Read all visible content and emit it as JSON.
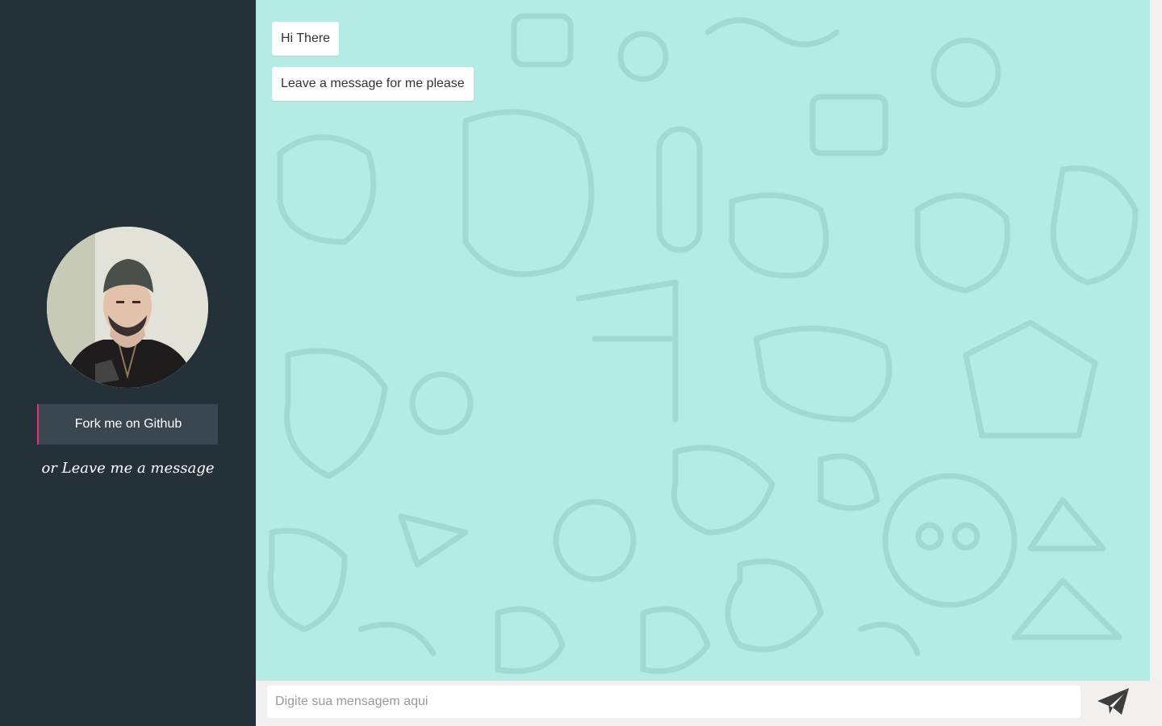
{
  "colors": {
    "sidebar_bg": "#243139",
    "chat_bg": "#b4ebe4",
    "button_bg": "#3a4650",
    "button_accent": "#e6336f",
    "composer_bg": "#f2f0ee",
    "send_icon": "#3d3d3d"
  },
  "sidebar": {
    "avatar_icon": "profile-photo",
    "fork_button_label": "Fork me on Github",
    "leave_message_text": "or Leave me a message"
  },
  "chat": {
    "messages": [
      {
        "text": "Hi There"
      },
      {
        "text": "Leave a message for me please"
      }
    ]
  },
  "composer": {
    "input_placeholder": "Digite sua mensagem aqui",
    "input_value": "",
    "send_icon": "paper-plane-icon"
  }
}
